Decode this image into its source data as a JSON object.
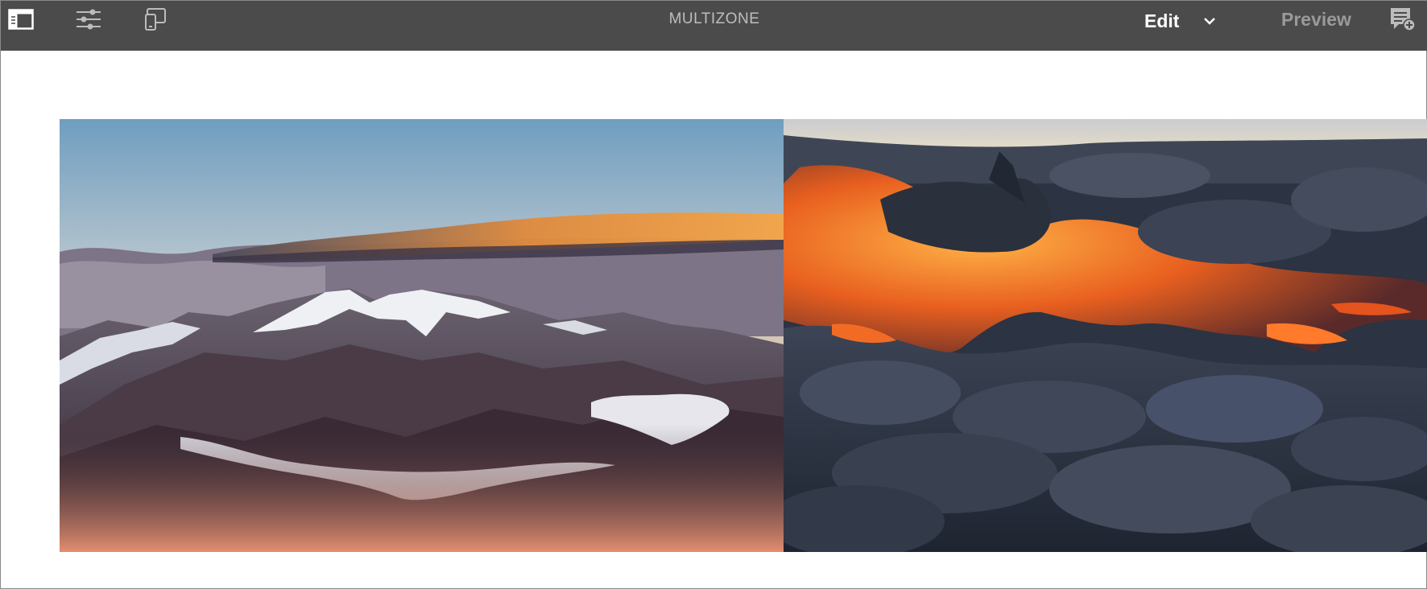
{
  "toolbar": {
    "title": "MULTIZONE",
    "mode_label": "Edit",
    "preview_label": "Preview",
    "icons": {
      "side_panel": "side-panel-toggle-icon",
      "page_properties": "sliders-icon",
      "emulator": "device-emulator-icon",
      "mode_menu": "chevron-down-icon",
      "annotate": "annotation-add-icon"
    }
  },
  "zones": [
    {
      "name": "mountain-image",
      "description_icon": "image"
    },
    {
      "name": "lava-image",
      "description_icon": "image"
    }
  ],
  "colors": {
    "toolbar_bg": "#4b4b4b",
    "title_text": "#bdbdbd",
    "edit_text": "#ffffff",
    "preview_text": "#9a9a9a"
  }
}
